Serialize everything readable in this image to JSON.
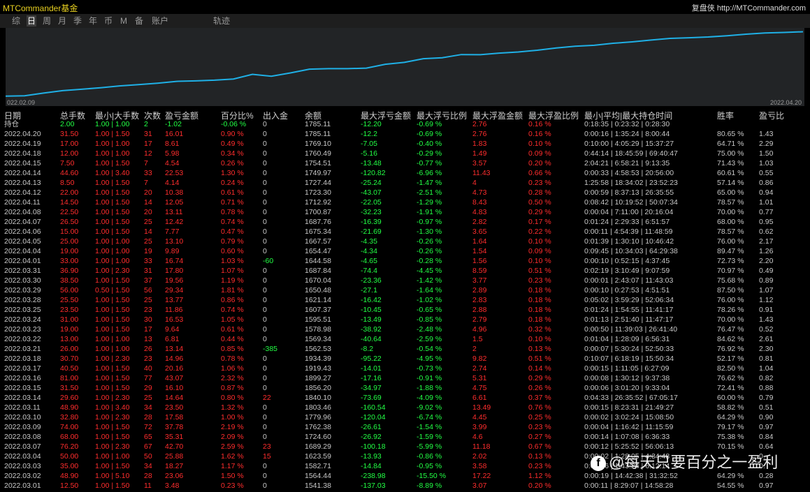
{
  "header": {
    "app_title": "MTCommander基金",
    "brand_label": "复盘侠",
    "brand_url": "http://MTCommander.com"
  },
  "tabs": [
    {
      "label": "综",
      "active": false
    },
    {
      "label": "日",
      "active": true
    },
    {
      "label": "周",
      "active": false
    },
    {
      "label": "月",
      "active": false
    },
    {
      "label": "季",
      "active": false
    },
    {
      "label": "年",
      "active": false
    },
    {
      "label": "币",
      "active": false
    },
    {
      "label": "M",
      "active": false
    },
    {
      "label": "备",
      "active": false
    },
    {
      "label": "账户",
      "active": false
    },
    {
      "label": "轨迹",
      "active": false
    }
  ],
  "chart_data": {
    "type": "line",
    "x_start_label": "022.02.09",
    "x_end_label": "2022.04.20",
    "line_color": "#1fb0e6",
    "background": "#222426",
    "series": [
      {
        "values": [
          1394.0,
          1396.2,
          1412.4,
          1427.7,
          1436.3,
          1445.5,
          1456.8,
          1464.4,
          1473.5,
          1484.4,
          1487.6,
          1491.8,
          1499.3,
          1527.8,
          1516.2,
          1536.5,
          1559.6,
          1562.5,
          1562.6,
          1566.2,
          1589.5,
          1601.1,
          1624.0,
          1630.0,
          1649.3,
          1648.5,
          1658.0,
          1664.9,
          1675.7,
          1690.0,
          1700.0,
          1706.1,
          1718.4,
          1727.0,
          1738.5,
          1748.4,
          1752.3,
          1757.1,
          1764.9,
          1774.3,
          1781.8,
          1785.1,
          1789.5
        ]
      }
    ],
    "ylim": [
      1380,
      1800
    ]
  },
  "table": {
    "headers": [
      "日期",
      "总手数",
      "最小|大手数",
      "次数",
      "盈亏金额",
      "百分比%",
      "出入金",
      "余额",
      "最大浮亏金额",
      "最大浮亏比例",
      "最大浮盈金额",
      "最大浮盈比例",
      "最小|平均|最大持仓时间",
      "胜率",
      "盈亏比"
    ],
    "holding": [
      "持仓",
      "2.00",
      "1.00 | 1.00",
      "2",
      "-1.02",
      "-0.06 %",
      "0",
      "1785.11",
      "-12.20",
      "-0.69 %",
      "2.76",
      "0.16 %",
      "0:18:35 | 0:23:32 | 0:28:30",
      "",
      ""
    ],
    "rows": [
      [
        "2022.04.20",
        "31.50",
        "1.00 | 1.50",
        "31",
        "16.01",
        "0.90 %",
        "0",
        "1785.11",
        "-12.2",
        "-0.69 %",
        "2.76",
        "0.16 %",
        "0:00:16 | 1:35:24 | 8:00:44",
        "80.65 %",
        "1.43"
      ],
      [
        "2022.04.19",
        "17.00",
        "1.00 | 1.00",
        "17",
        "8.61",
        "0.49 %",
        "0",
        "1769.10",
        "-7.05",
        "-0.40 %",
        "1.83",
        "0.10 %",
        "0:10:00 | 4:05:29 | 15:37:27",
        "64.71 %",
        "2.29"
      ],
      [
        "2022.04.18",
        "12.00",
        "1.00 | 1.00",
        "12",
        "5.98",
        "0.34 %",
        "0",
        "1760.49",
        "-5.16",
        "-0.29 %",
        "1.49",
        "0.09 %",
        "0:44:14 | 18:45:59 | 69:40:47",
        "75.00 %",
        "1.50"
      ],
      [
        "2022.04.15",
        "7.50",
        "1.00 | 1.50",
        "7",
        "4.54",
        "0.26 %",
        "0",
        "1754.51",
        "-13.48",
        "-0.77 %",
        "3.57",
        "0.20 %",
        "2:04:21 | 6:58:21 | 9:13:35",
        "71.43 %",
        "1.03"
      ],
      [
        "2022.04.14",
        "44.60",
        "1.00 | 3.40",
        "33",
        "22.53",
        "1.30 %",
        "0",
        "1749.97",
        "-120.82",
        "-6.96 %",
        "11.43",
        "0.66 %",
        "0:00:33 | 4:58:53 | 20:56:00",
        "60.61 %",
        "0.55"
      ],
      [
        "2022.04.13",
        "8.50",
        "1.00 | 1.50",
        "7",
        "4.14",
        "0.24 %",
        "0",
        "1727.44",
        "-25.24",
        "-1.47 %",
        "4",
        "0.23 %",
        "1:25:58 | 18:34:02 | 23:52:23",
        "57.14 %",
        "0.86"
      ],
      [
        "2022.04.12",
        "22.00",
        "1.00 | 1.50",
        "20",
        "10.38",
        "0.61 %",
        "0",
        "1723.30",
        "-43.07",
        "-2.51 %",
        "4.73",
        "0.28 %",
        "0:00:59 | 8:37:13 | 26:35:55",
        "65.00 %",
        "0.94"
      ],
      [
        "2022.04.11",
        "14.50",
        "1.00 | 1.50",
        "14",
        "12.05",
        "0.71 %",
        "0",
        "1712.92",
        "-22.05",
        "-1.29 %",
        "8.43",
        "0.50 %",
        "0:08:42 | 10:19:52 | 50:07:34",
        "78.57 %",
        "1.01"
      ],
      [
        "2022.04.08",
        "22.50",
        "1.00 | 1.50",
        "20",
        "13.11",
        "0.78 %",
        "0",
        "1700.87",
        "-32.23",
        "-1.91 %",
        "4.83",
        "0.29 %",
        "0:00:04 | 7:11:00 | 20:16:04",
        "70.00 %",
        "0.77"
      ],
      [
        "2022.04.07",
        "26.50",
        "1.00 | 1.50",
        "25",
        "12.42",
        "0.74 %",
        "0",
        "1687.76",
        "-16.39",
        "-0.97 %",
        "2.82",
        "0.17 %",
        "0:01:24 | 2:29:33 | 6:51:57",
        "68.00 %",
        "0.95"
      ],
      [
        "2022.04.06",
        "15.00",
        "1.00 | 1.50",
        "14",
        "7.77",
        "0.47 %",
        "0",
        "1675.34",
        "-21.69",
        "-1.30 %",
        "3.65",
        "0.22 %",
        "0:00:11 | 4:54:39 | 11:48:59",
        "78.57 %",
        "0.62"
      ],
      [
        "2022.04.05",
        "25.00",
        "1.00 | 1.00",
        "25",
        "13.10",
        "0.79 %",
        "0",
        "1667.57",
        "-4.35",
        "-0.26 %",
        "1.64",
        "0.10 %",
        "0:01:39 | 1:30:10 | 10:46:42",
        "76.00 %",
        "2.17"
      ],
      [
        "2022.04.04",
        "19.00",
        "1.00 | 1.00",
        "19",
        "9.89",
        "0.60 %",
        "0",
        "1654.47",
        "-4.34",
        "-0.26 %",
        "1.54",
        "0.09 %",
        "0:09:45 | 10:34:03 | 64:29:38",
        "89.47 %",
        "1.26"
      ],
      [
        "2022.04.01",
        "33.00",
        "1.00 | 1.00",
        "33",
        "16.74",
        "1.03 %",
        "-60",
        "1644.58",
        "-4.65",
        "-0.28 %",
        "1.56",
        "0.10 %",
        "0:00:10 | 0:52:15 | 4:37:45",
        "72.73 %",
        "2.20"
      ],
      [
        "2022.03.31",
        "36.90",
        "1.00 | 2.30",
        "31",
        "17.80",
        "1.07 %",
        "0",
        "1687.84",
        "-74.4",
        "-4.45 %",
        "8.59",
        "0.51 %",
        "0:02:19 | 3:10:49 | 9:07:59",
        "70.97 %",
        "0.49"
      ],
      [
        "2022.03.30",
        "38.50",
        "1.00 | 1.50",
        "37",
        "19.56",
        "1.19 %",
        "0",
        "1670.04",
        "-23.36",
        "-1.42 %",
        "3.77",
        "0.23 %",
        "0:00:01 | 2:43:07 | 11:43:03",
        "75.68 %",
        "0.89"
      ],
      [
        "2022.03.29",
        "56.00",
        "0.50 | 1.50",
        "56",
        "29.34",
        "1.81 %",
        "0",
        "1650.48",
        "-27.1",
        "-1.64 %",
        "2.89",
        "0.18 %",
        "0:00:10 | 0:27:53 | 4:51:51",
        "87.50 %",
        "1.07"
      ],
      [
        "2022.03.28",
        "25.50",
        "1.00 | 1.50",
        "25",
        "13.77",
        "0.86 %",
        "0",
        "1621.14",
        "-16.42",
        "-1.02 %",
        "2.83",
        "0.18 %",
        "0:05:02 | 3:59:29 | 52:06:34",
        "76.00 %",
        "1.12"
      ],
      [
        "2022.03.25",
        "23.50",
        "1.00 | 1.50",
        "23",
        "11.86",
        "0.74 %",
        "0",
        "1607.37",
        "-10.45",
        "-0.65 %",
        "2.88",
        "0.18 %",
        "0:01:24 | 1:54:55 | 11:41:17",
        "78.26 %",
        "0.91"
      ],
      [
        "2022.03.24",
        "31.00",
        "1.00 | 1.50",
        "30",
        "16.53",
        "1.05 %",
        "0",
        "1595.51",
        "-13.49",
        "-0.85 %",
        "2.79",
        "0.18 %",
        "0:01:13 | 2:51:40 | 11:47:17",
        "70.00 %",
        "1.43"
      ],
      [
        "2022.03.23",
        "19.00",
        "1.00 | 1.50",
        "17",
        "9.64",
        "0.61 %",
        "0",
        "1578.98",
        "-38.92",
        "-2.48 %",
        "4.96",
        "0.32 %",
        "0:00:50 | 11:39:03 | 26:41:40",
        "76.47 %",
        "0.52"
      ],
      [
        "2022.03.22",
        "13.00",
        "1.00 | 1.00",
        "13",
        "6.81",
        "0.44 %",
        "0",
        "1569.34",
        "-40.64",
        "-2.59 %",
        "1.5",
        "0.10 %",
        "0:01:04 | 1:28:09 | 6:56:31",
        "84.62 %",
        "2.61"
      ],
      [
        "2022.03.21",
        "26.00",
        "1.00 | 1.00",
        "26",
        "13.14",
        "0.85 %",
        "-385",
        "1562.53",
        "-8.2",
        "-0.54 %",
        "2",
        "0.13 %",
        "0:00:07 | 5:30:24 | 52:50:33",
        "76.92 %",
        "2.30"
      ],
      [
        "2022.03.18",
        "30.70",
        "1.00 | 2.30",
        "23",
        "14.96",
        "0.78 %",
        "0",
        "1934.39",
        "-95.22",
        "-4.95 %",
        "9.82",
        "0.51 %",
        "0:10:07 | 6:18:19 | 15:50:34",
        "52.17 %",
        "0.81"
      ],
      [
        "2022.03.17",
        "40.50",
        "1.00 | 1.50",
        "40",
        "20.16",
        "1.06 %",
        "0",
        "1919.43",
        "-14.01",
        "-0.73 %",
        "2.74",
        "0.14 %",
        "0:00:15 | 1:11:05 | 6:27:09",
        "82.50 %",
        "1.04"
      ],
      [
        "2022.03.16",
        "81.00",
        "1.00 | 1.50",
        "77",
        "43.07",
        "2.32 %",
        "0",
        "1899.27",
        "-17.16",
        "-0.91 %",
        "5.31",
        "0.29 %",
        "0:00:08 | 1:30:12 | 9:37:38",
        "76.62 %",
        "0.82"
      ],
      [
        "2022.03.15",
        "31.50",
        "1.00 | 1.50",
        "29",
        "16.10",
        "0.87 %",
        "0",
        "1856.20",
        "-34.97",
        "-1.88 %",
        "4.75",
        "0.26 %",
        "0:00:06 | 3:01:20 | 9:33:04",
        "72.41 %",
        "0.88"
      ],
      [
        "2022.03.14",
        "29.60",
        "1.00 | 2.30",
        "25",
        "14.64",
        "0.80 %",
        "22",
        "1840.10",
        "-73.69",
        "-4.09 %",
        "6.61",
        "0.37 %",
        "0:04:33 | 26:35:52 | 67:05:17",
        "60.00 %",
        "0.79"
      ],
      [
        "2022.03.11",
        "48.90",
        "1.00 | 3.40",
        "34",
        "23.50",
        "1.32 %",
        "0",
        "1803.46",
        "-160.54",
        "-9.02 %",
        "13.49",
        "0.76 %",
        "0:00:15 | 8:23:31 | 21:49:27",
        "58.82 %",
        "0.51"
      ],
      [
        "2022.03.10",
        "32.80",
        "1.00 | 2.30",
        "28",
        "17.58",
        "1.00 %",
        "0",
        "1779.96",
        "-120.04",
        "-6.74 %",
        "4.45",
        "0.25 %",
        "0:00:02 | 3:02:24 | 15:08:50",
        "64.29 %",
        "0.90"
      ],
      [
        "2022.03.09",
        "74.00",
        "1.00 | 1.50",
        "72",
        "37.78",
        "2.19 %",
        "0",
        "1762.38",
        "-26.61",
        "-1.54 %",
        "3.99",
        "0.23 %",
        "0:00:04 | 1:16:42 | 11:15:59",
        "79.17 %",
        "0.97"
      ],
      [
        "2022.03.08",
        "68.00",
        "1.00 | 1.50",
        "65",
        "35.31",
        "2.09 %",
        "0",
        "1724.60",
        "-26.92",
        "-1.59 %",
        "4.6",
        "0.27 %",
        "0:00:14 | 1:07:08 | 6:36:33",
        "75.38 %",
        "0.84"
      ],
      [
        "2022.03.07",
        "76.20",
        "1.00 | 2.30",
        "67",
        "42.70",
        "2.59 %",
        "23",
        "1689.29",
        "-100.18",
        "-5.99 %",
        "11.18",
        "0.67 %",
        "0:00:12 | 5:25:52 | 56:06:13",
        "70.15 %",
        "0.64"
      ],
      [
        "2022.03.04",
        "50.00",
        "1.00 | 1.00",
        "50",
        "25.88",
        "1.62 %",
        "15",
        "1623.59",
        "-13.93",
        "-0.86 %",
        "2.02",
        "0.13 %",
        "0:00:02 | 1:28:05 | 4:34:48",
        "",
        "0."
      ],
      [
        "2022.03.03",
        "35.00",
        "1.00 | 1.50",
        "34",
        "18.27",
        "1.17 %",
        "0",
        "1582.71",
        "-14.84",
        "-0.95 %",
        "3.58",
        "0.23 %",
        "0:00:06 | 1:43:24 | 6:12:14",
        "",
        "0."
      ],
      [
        "2022.03.02",
        "48.90",
        "1.00 | 5.10",
        "28",
        "23.06",
        "1.50 %",
        "0",
        "1564.44",
        "-238.98",
        "-15.50 %",
        "17.22",
        "1.12 %",
        "0:00:19 | 14:42:38 | 31:32:52",
        "64.29 %",
        "0.28"
      ],
      [
        "2022.03.01",
        "12.50",
        "1.00 | 1.50",
        "11",
        "3.48",
        "0.23 %",
        "0",
        "1541.38",
        "-137.03",
        "-8.89 %",
        "3.07",
        "0.20 %",
        "0:00:11 | 8:29:07 | 14:58:28",
        "54.55 %",
        "0.97"
      ]
    ]
  },
  "watermark": {
    "logo": "f",
    "text": "@每天只要百分之一盈利"
  },
  "colors": {
    "positive": "#ff2d2d",
    "negative": "#22ff44",
    "neutral": "#c8c8c8",
    "title": "#e8d020"
  }
}
